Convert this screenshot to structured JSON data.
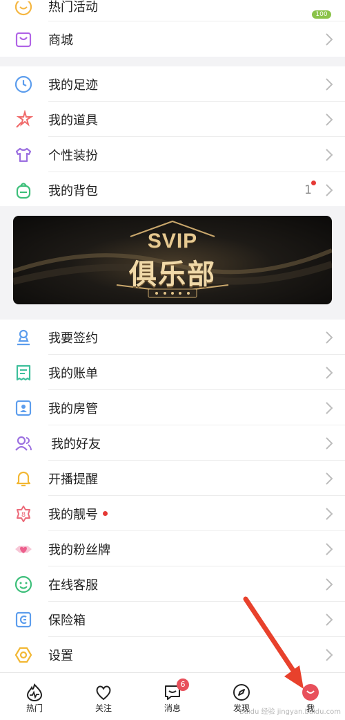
{
  "menu_top": [
    {
      "label": "热门活动",
      "badge": "100"
    },
    {
      "label": "商城"
    }
  ],
  "menu_mid": [
    {
      "label": "我的足迹"
    },
    {
      "label": "我的道具"
    },
    {
      "label": "个性装扮"
    },
    {
      "label": "我的背包",
      "count": "1"
    }
  ],
  "banner": {
    "line1": "SVIP",
    "line2": "俱乐部"
  },
  "menu_bottom": [
    {
      "label": "我要签约"
    },
    {
      "label": "我的账单"
    },
    {
      "label": "我的房管"
    },
    {
      "label": "我的好友"
    },
    {
      "label": "开播提醒"
    },
    {
      "label": "我的靓号"
    },
    {
      "label": "我的粉丝牌"
    },
    {
      "label": "在线客服"
    },
    {
      "label": "保险箱"
    },
    {
      "label": "设置"
    }
  ],
  "tabbar": [
    {
      "label": "热门"
    },
    {
      "label": "关注"
    },
    {
      "label": "消息",
      "badge": "6"
    },
    {
      "label": "发现"
    },
    {
      "label": "我"
    }
  ],
  "watermark": "Baidu 经验 jingyan.baidu.com",
  "colors": {
    "accent_red": "#e53935",
    "badge_red": "#e8505b",
    "arrow_red": "#e8412c"
  }
}
